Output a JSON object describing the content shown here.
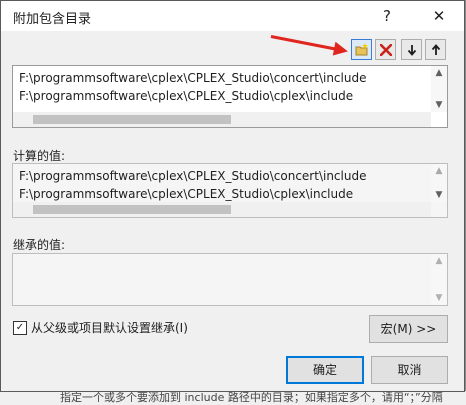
{
  "background_text": "指定一个或多个要添加到 include 路径中的目录；如果指定多个，请用“；”分隔",
  "dialog": {
    "title": "附加包含目录",
    "help_label": "?",
    "close_label": "✕"
  },
  "toolbar": {
    "new_folder_icon": "new-folder-icon",
    "delete_icon": "delete-icon",
    "move_down_icon": "move-down-icon",
    "move_up_icon": "move-up-icon",
    "accent_color": "#e0241e"
  },
  "directories": [
    "F:\\programmsoftware\\cplex\\CPLEX_Studio\\concert\\include",
    "F:\\programmsoftware\\cplex\\CPLEX_Studio\\cplex\\include"
  ],
  "evaluated": {
    "label": "计算的值:",
    "lines": [
      "F:\\programmsoftware\\cplex\\CPLEX_Studio\\concert\\include",
      "F:\\programmsoftware\\cplex\\CPLEX_Studio\\cplex\\include"
    ]
  },
  "inherited": {
    "label": "继承的值:",
    "lines": []
  },
  "inherit_checkbox": {
    "label": "从父级或项目默认设置继承(I)",
    "checked": true
  },
  "buttons": {
    "macros": "宏(M) >>",
    "ok": "确定",
    "cancel": "取消"
  }
}
